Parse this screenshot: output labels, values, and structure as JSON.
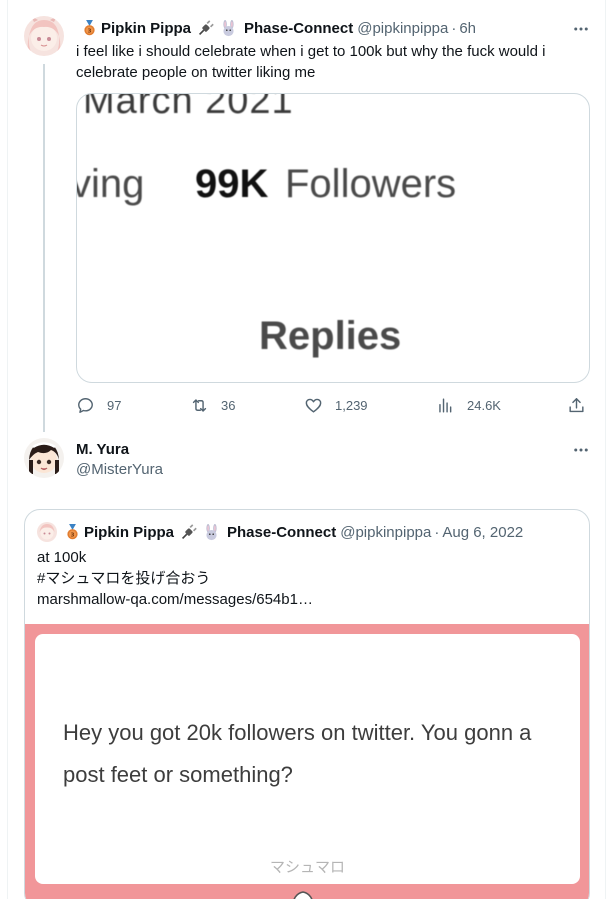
{
  "tweet": {
    "display_name": "Pipkin Pippa",
    "org_name": "Phase-Connect",
    "handle": "@pipkinpippa",
    "separator": "·",
    "time": "6h",
    "text": "i feel like i should celebrate when i get to 100k but why the fuck would i celebrate people on twitter liking me",
    "media": {
      "month_text": "March 2021",
      "following_fragment": "ving",
      "follower_count": "99K",
      "followers_label": "Followers",
      "replies_label": "Replies"
    },
    "actions": {
      "reply_count": "97",
      "retweet_count": "36",
      "like_count": "1,239",
      "view_count": "24.6K"
    }
  },
  "reply": {
    "display_name": "M. Yura",
    "handle": "@MisterYura"
  },
  "quote": {
    "display_name": "Pipkin Pippa",
    "org_name": "Phase-Connect",
    "handle": "@pipkinpippa",
    "separator": "·",
    "date": "Aug 6, 2022",
    "line1": "at 100k",
    "line2": "#マシュマロを投げ合おう",
    "link": "marshmallow-qa.com/messages/654b1…",
    "media": {
      "question": "Hey you got 20k followers on twitter. You gonn a post feet or something?",
      "brand": "マシュマロ"
    }
  },
  "colors": {
    "text_primary": "#0f1419",
    "text_secondary": "#536471",
    "border": "#cfd9de",
    "marshmallow_bg": "#f19699"
  },
  "icons": {
    "medal": "medal-icon",
    "plug": "plug-icon",
    "rabbit": "rabbit-icon",
    "more": "more-icon",
    "reply": "reply-icon",
    "retweet": "retweet-icon",
    "like": "like-icon",
    "views": "views-icon",
    "share": "share-icon"
  }
}
